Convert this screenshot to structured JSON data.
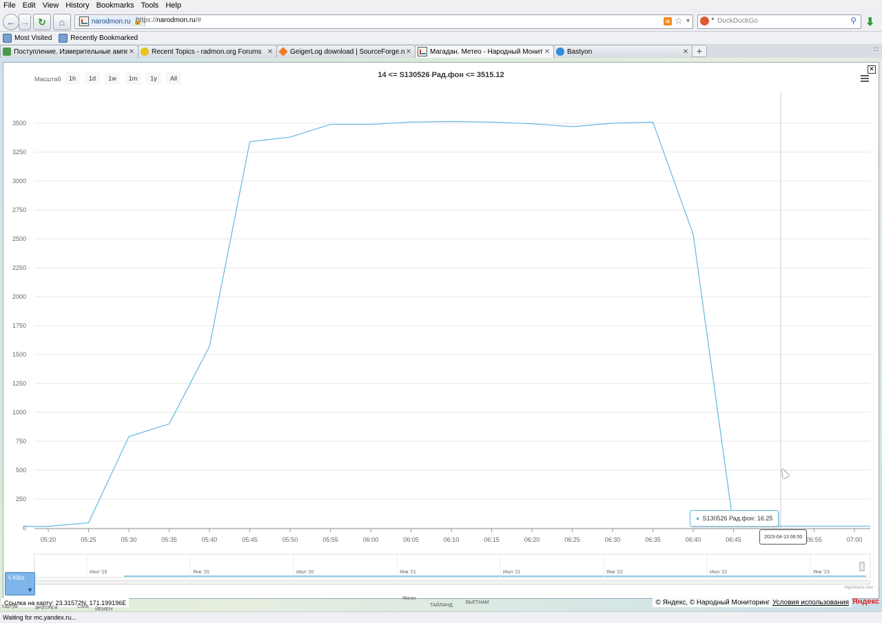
{
  "menu": [
    "File",
    "Edit",
    "View",
    "History",
    "Bookmarks",
    "Tools",
    "Help"
  ],
  "url": {
    "domain": "narodmon.ru",
    "prefix": "https://",
    "host": "narodmon.ru",
    "path": "/#"
  },
  "search": {
    "placeholder": "DuckDuckGo"
  },
  "bookmarks": [
    "Most Visited",
    "Recently Bookmarked"
  ],
  "tabs": [
    {
      "label": "Поступление. Измерительные амперм...",
      "icon_color": "#4a9a4a"
    },
    {
      "label": "Recent Topics - radmon.org Forums",
      "icon_color": "#e8c21a"
    },
    {
      "label": "GeigerLog download | SourceForge.net",
      "icon_color": "#f07b2a"
    },
    {
      "label": "Магадан. Метео - Народный Мониторинг",
      "icon_color": "#c33"
    },
    {
      "label": "Bastyon",
      "icon_color": "#2f8fd8"
    }
  ],
  "chart": {
    "zoom_label": "Масштаб",
    "zoom_buttons": [
      "1h",
      "1d",
      "1w",
      "1m",
      "1y",
      "All"
    ],
    "tooltip": "S130526 Рад.фон: 16.25",
    "tooltip_date": "2023-04-13 06:50",
    "credits": "Highcharts.com",
    "series_color": "#5fb8e0"
  },
  "chart_data": {
    "type": "line",
    "title": "14 <= S130526 Рад.фон <= 3515.12",
    "series": [
      {
        "name": "S130526 Рад.фон",
        "x": [
          "05:17",
          "05:20",
          "05:25",
          "05:30",
          "05:35",
          "05:40",
          "05:45",
          "05:50",
          "05:55",
          "06:00",
          "06:05",
          "06:10",
          "06:15",
          "06:20",
          "06:25",
          "06:30",
          "06:35",
          "06:40",
          "06:45",
          "06:50",
          "06:55",
          "07:00",
          "07:02"
        ],
        "values": [
          14,
          14,
          45,
          790,
          900,
          1570,
          3340,
          3380,
          3490,
          3490,
          3510,
          3515,
          3510,
          3495,
          3470,
          3500,
          3510,
          2540,
          16,
          16,
          16,
          16,
          16
        ]
      }
    ],
    "y_ticks": [
      0,
      250,
      500,
      750,
      1000,
      1250,
      1500,
      1750,
      2000,
      2250,
      2500,
      2750,
      3000,
      3250,
      3500
    ],
    "x_ticks": [
      "05:20",
      "05:25",
      "05:30",
      "05:35",
      "05:40",
      "05:45",
      "05:50",
      "05:55",
      "06:00",
      "06:05",
      "06:10",
      "06:15",
      "06:20",
      "06:25",
      "06:30",
      "06:35",
      "06:40",
      "06:45",
      "06:50",
      "06:55",
      "07:00"
    ],
    "ylim": [
      0,
      3500
    ],
    "grid": true,
    "navigator_labels": [
      "Июл '19",
      "Янв '20",
      "Июл '20",
      "Янв '21",
      "Июл '21",
      "Янв '22",
      "Июл '22",
      "Янв '23"
    ]
  },
  "netspeed": "5 KB/s",
  "map": {
    "coords": "Ссылка на карту: 23.31572N, 171.199196E",
    "labels": [
      "Хартум",
      "ЭРИТРЕЯ",
      "Сана",
      "ЙЕМЕН",
      "Янгон",
      "ТАЙЛАНД",
      "ВЬЕТНАМ"
    ],
    "copyright": "© Яндекс, © Народный Мониторинг",
    "terms": "Условия использования",
    "logo": "Яндекс"
  },
  "status": "Waiting for mc.yandex.ru..."
}
